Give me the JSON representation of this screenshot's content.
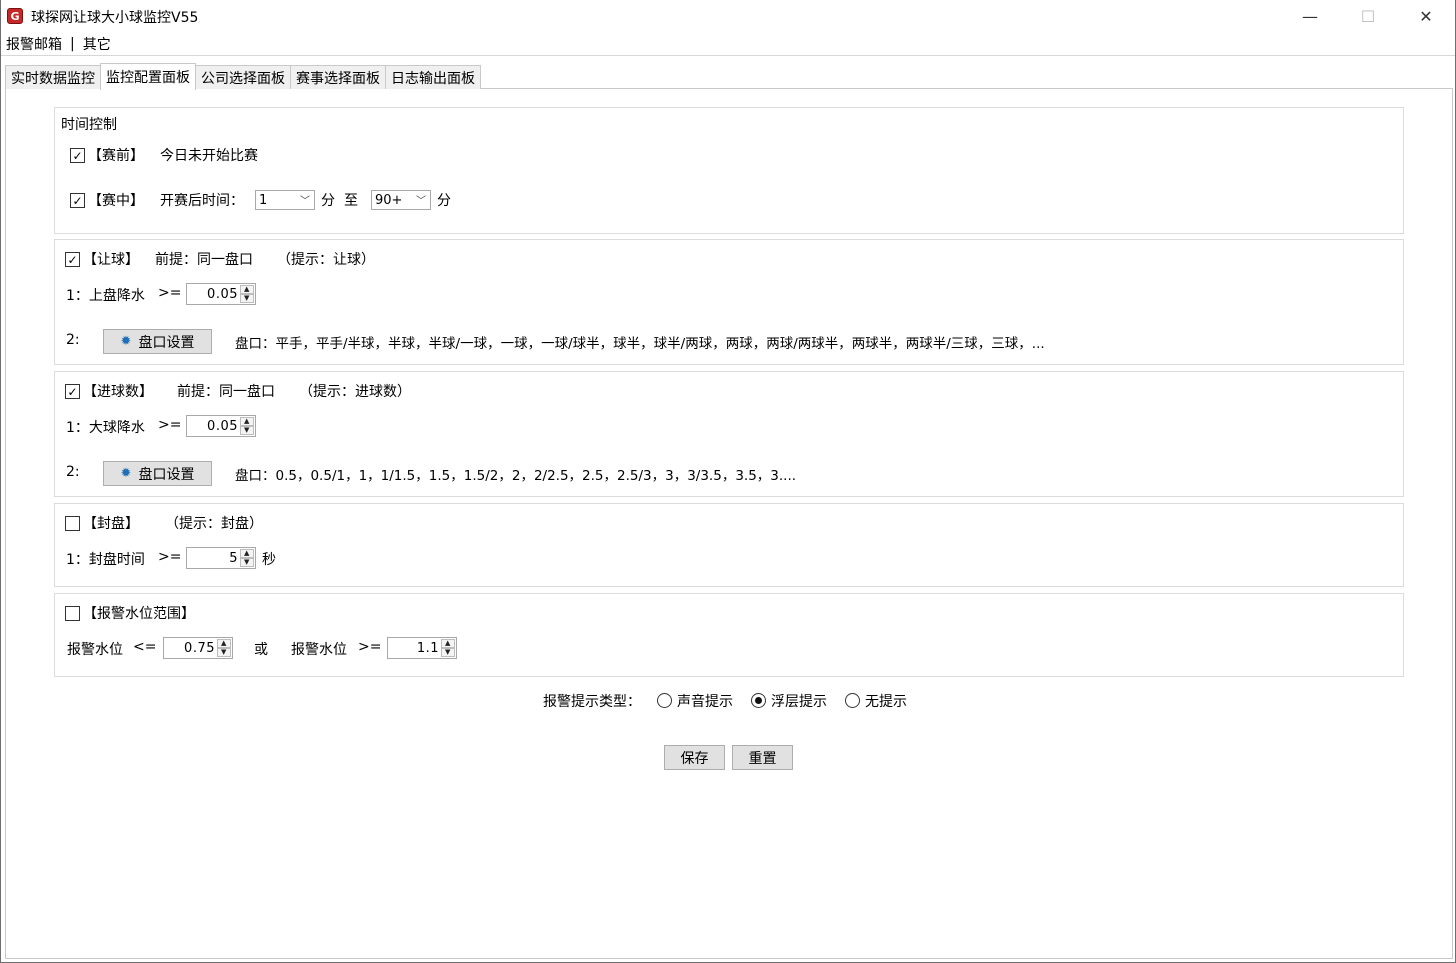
{
  "window": {
    "title": "球探网让球大小球监控V55",
    "icon": "app-logo-icon",
    "controls": {
      "minimize": "—",
      "maximize": "☐",
      "close": "✕"
    }
  },
  "menu": {
    "items": [
      "报警邮箱",
      "其它"
    ],
    "separator": "|"
  },
  "tabs": [
    {
      "label": "实时数据监控",
      "active": false
    },
    {
      "label": "监控配置面板",
      "active": true
    },
    {
      "label": "公司选择面板",
      "active": false
    },
    {
      "label": "赛事选择面板",
      "active": false
    },
    {
      "label": "日志输出面板",
      "active": false
    }
  ],
  "time_control": {
    "heading": "时间控制",
    "prematch": {
      "checked": true,
      "label": "【赛前】",
      "desc": "今日未开始比赛"
    },
    "inplay": {
      "checked": true,
      "label": "【赛中】",
      "prefix": "开赛后时间：",
      "from_value": "1",
      "unit1": "分",
      "to_word": "至",
      "to_value": "90+",
      "unit2": "分"
    }
  },
  "handicap": {
    "checked": true,
    "label": "【让球】",
    "premise": "前提：同一盘口",
    "hint": "（提示：让球）",
    "row1_label": "1：上盘降水",
    "row1_op": ">=",
    "row1_value": "0.05",
    "row2_label": "2:",
    "settings_button": "盘口设置",
    "lines": "盘口：平手，平手/半球，半球，半球/一球，一球，一球/球半，球半，球半/两球，两球，两球/两球半，两球半，两球半/三球，三球，..."
  },
  "goals": {
    "checked": true,
    "label": "【进球数】",
    "premise": "前提：同一盘口",
    "hint": "（提示：进球数）",
    "row1_label": "1：大球降水",
    "row1_op": ">=",
    "row1_value": "0.05",
    "row2_label": "2:",
    "settings_button": "盘口设置",
    "lines": "盘口：0.5，0.5/1，1，1/1.5，1.5，1.5/2，2，2/2.5，2.5，2.5/3，3，3/3.5，3.5，3...."
  },
  "closing": {
    "checked": false,
    "label": "【封盘】",
    "hint": "（提示：封盘）",
    "row1_label": "1：封盘时间",
    "row1_op": ">=",
    "row1_value": "5",
    "unit": "秒"
  },
  "alarm_range": {
    "checked": false,
    "label": "【报警水位范围】",
    "low_label": "报警水位",
    "low_op": "<=",
    "low_value": "0.75",
    "or_word": "或",
    "high_label": "报警水位",
    "high_op": ">=",
    "high_value": "1.1"
  },
  "alert_type": {
    "label": "报警提示类型：",
    "options": [
      {
        "label": "声音提示",
        "selected": false
      },
      {
        "label": "浮层提示",
        "selected": true
      },
      {
        "label": "无提示",
        "selected": false
      }
    ]
  },
  "actions": {
    "save": "保存",
    "reset": "重置"
  }
}
